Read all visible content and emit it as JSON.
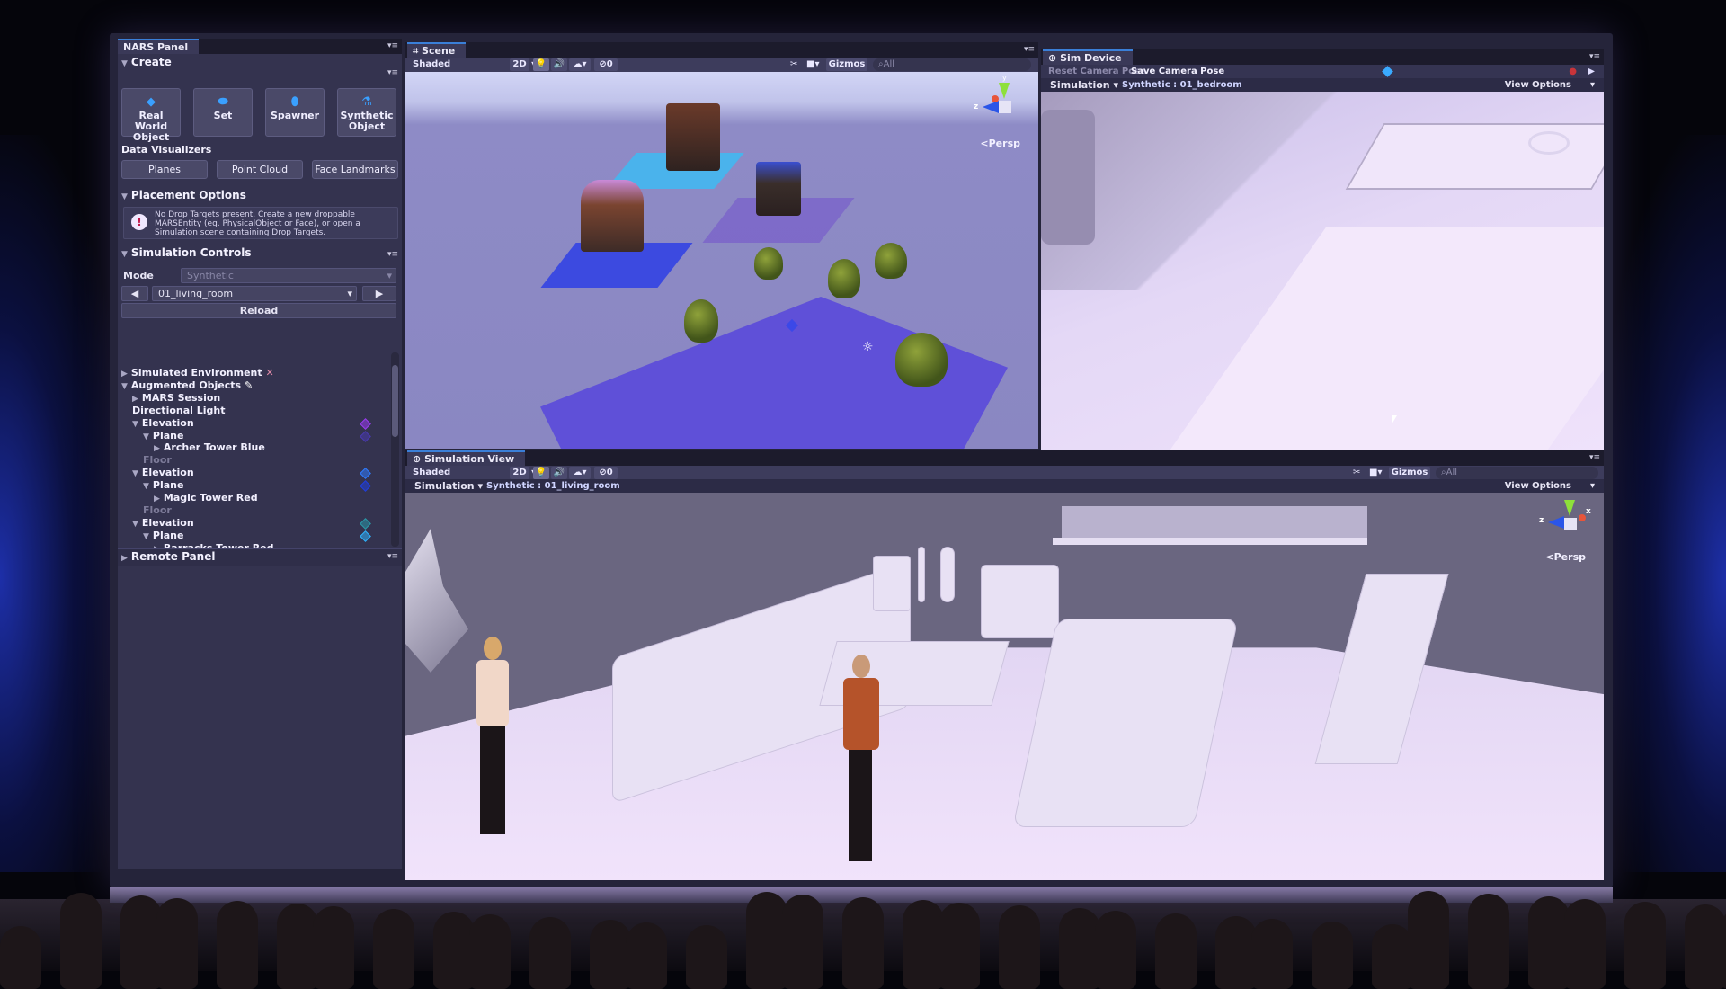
{
  "nars_panel": {
    "tab_title": "NARS Panel",
    "create": {
      "header": "Create",
      "buttons": [
        {
          "label": "Real World Object",
          "icon": "diamond-icon"
        },
        {
          "label": "Set",
          "icon": "set-icon"
        },
        {
          "label": "Spawner",
          "icon": "spawner-icon"
        },
        {
          "label": "Synthetic Object",
          "icon": "flask-icon"
        }
      ]
    },
    "data_visualizers": {
      "header": "Data Visualizers",
      "buttons": [
        "Planes",
        "Point Cloud",
        "Face Landmarks"
      ]
    },
    "placement_options": {
      "header": "Placement Options",
      "help_text": "No Drop Targets present. Create a new droppable MARSEntity (eg. PhysicalObject or Face), or open a Simulation scene containing Drop Targets."
    },
    "simulation_controls": {
      "header": "Simulation Controls",
      "mode_label": "Mode",
      "mode_value": "Synthetic",
      "scene_value": "01_living_room",
      "reload_label": "Reload"
    },
    "hierarchy": [
      {
        "label": "Simulated Environment",
        "depth": 0,
        "arrow": "right",
        "suffix_icon": "tools-icon"
      },
      {
        "label": "Augmented Objects",
        "depth": 0,
        "arrow": "down",
        "suffix_icon": "pencil-icon"
      },
      {
        "label": "MARS Session",
        "depth": 1,
        "arrow": "right"
      },
      {
        "label": "Directional Light",
        "depth": 1,
        "arrow": "none"
      },
      {
        "label": "Elevation",
        "depth": 1,
        "arrow": "down",
        "gem": "#9a3cf0"
      },
      {
        "label": "Plane",
        "depth": 2,
        "arrow": "down",
        "gem": "#4a3ab0"
      },
      {
        "label": "Archer Tower Blue",
        "depth": 3,
        "arrow": "right"
      },
      {
        "label": "Floor",
        "depth": 2,
        "arrow": "none",
        "muted": true
      },
      {
        "label": "Elevation",
        "depth": 1,
        "arrow": "down",
        "gem": "#2f7bff"
      },
      {
        "label": "Plane",
        "depth": 2,
        "arrow": "down",
        "gem": "#1f3fe0"
      },
      {
        "label": "Magic Tower Red",
        "depth": 3,
        "arrow": "right"
      },
      {
        "label": "Floor",
        "depth": 2,
        "arrow": "none",
        "muted": true
      },
      {
        "label": "Elevation",
        "depth": 1,
        "arrow": "down",
        "gem": "#2a9aa8"
      },
      {
        "label": "Plane",
        "depth": 2,
        "arrow": "down",
        "gem": "#2fb4ff"
      },
      {
        "label": "Barracks Tower Red",
        "depth": 3,
        "arrow": "right"
      }
    ],
    "remote_panel": "Remote Panel"
  },
  "scene_view": {
    "tab_title": "Scene",
    "shading_mode": "Shaded",
    "toggle_2d": "2D",
    "hidden_count": "0",
    "gizmos_label": "Gizmos",
    "search_placeholder": "All",
    "projection": "Persp",
    "axis_labels": {
      "y": "y",
      "z": "z"
    }
  },
  "sim_device": {
    "tab_title": "Sim Device",
    "reset_camera_pose": "Reset Camera Pose",
    "save_camera_pose": "Save Camera Pose",
    "simulation_menu": "Simulation",
    "environment_label": "Synthetic : 01_bedroom",
    "view_options": "View Options"
  },
  "simulation_view": {
    "tab_title": "Simulation View",
    "shading_mode": "Shaded",
    "toggle_2d": "2D",
    "hidden_count": "0",
    "simulation_menu": "Simulation",
    "environment_label": "Synthetic : 01_living_room",
    "gizmos_label": "Gizmos",
    "search_placeholder": "All",
    "view_options": "View Options",
    "projection": "Persp",
    "axis_labels": {
      "z": "z",
      "x": "x"
    }
  },
  "colors": {
    "panel_bg": "#34334f",
    "accent_blue": "#3a7fd8",
    "scene_ground": "#8a87c2",
    "plane_blue": "#3b3fd8",
    "plane_cyan": "#3fb6f0",
    "plane_purple": "#7a5fcf"
  }
}
